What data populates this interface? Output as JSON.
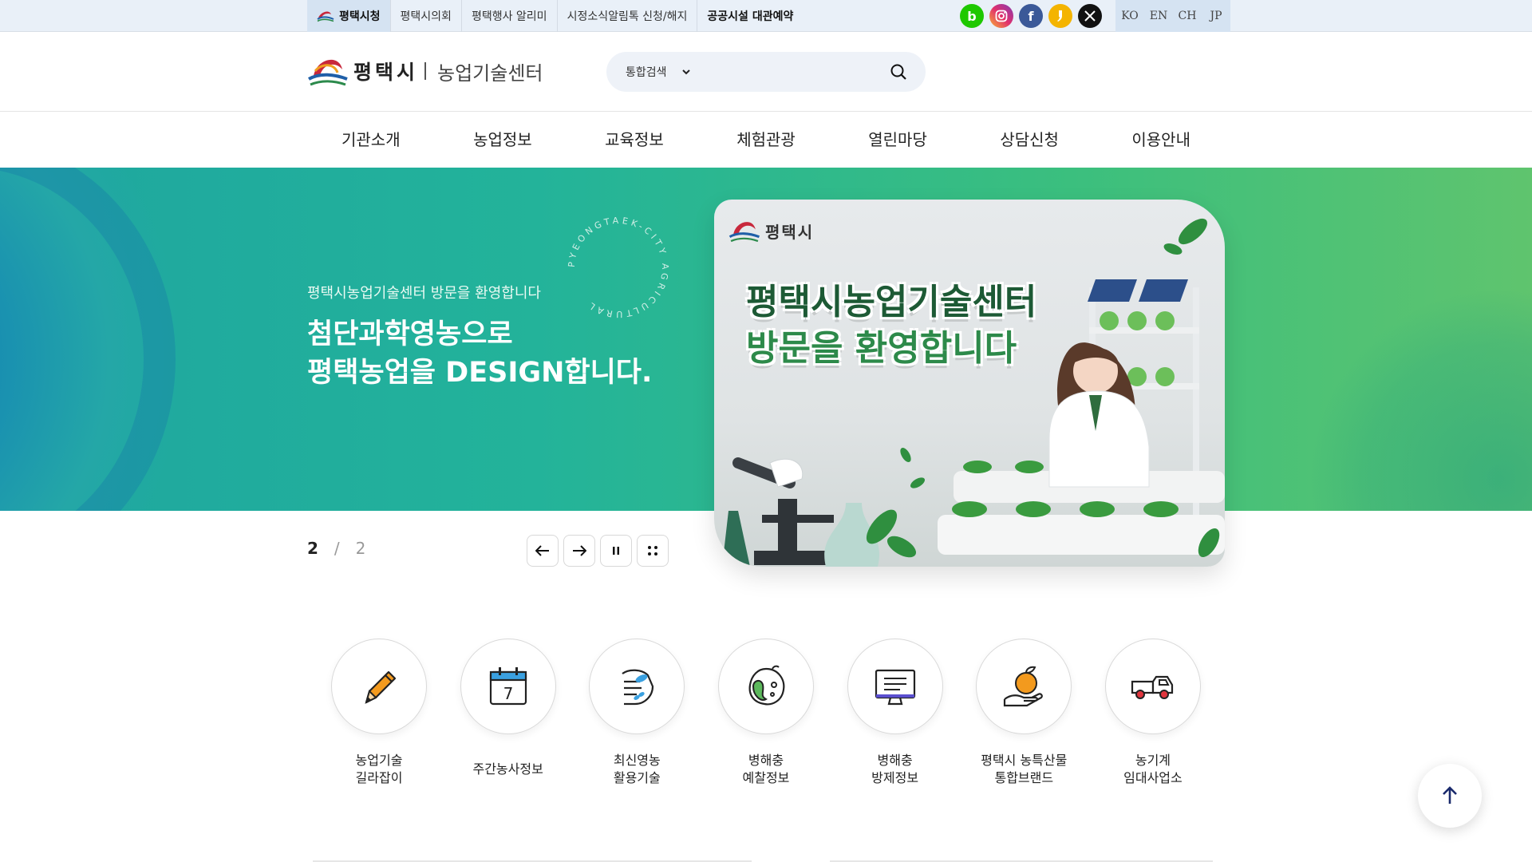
{
  "topbar": {
    "links": [
      "평택시청",
      "평택시의회",
      "평택행사 알리미",
      "시정소식알림톡 신청/해지",
      "공공시설 대관예약"
    ],
    "socials": [
      {
        "name": "blog",
        "glyph": "b",
        "color": "#1ec800"
      },
      {
        "name": "instagram",
        "glyph": "◎",
        "color": "#d6249f"
      },
      {
        "name": "facebook",
        "glyph": "f",
        "color": "#3b5998"
      },
      {
        "name": "kakao",
        "glyph": "❜",
        "color": "#f4b400"
      },
      {
        "name": "x",
        "glyph": "𝕏",
        "color": "#111111"
      }
    ],
    "languages": [
      "KO",
      "EN",
      "CH",
      "JP"
    ]
  },
  "header": {
    "logo_city": "평택시",
    "logo_org": "농업기술센터",
    "search_scope": "통합검색",
    "search_placeholder": ""
  },
  "gnb": [
    "기관소개",
    "농업정보",
    "교육정보",
    "체험관광",
    "열린마당",
    "상담신청",
    "이용안내"
  ],
  "hero": {
    "subtitle": "평택시농업기술센터 방문을 환영합니다",
    "title_line1": "첨단과학영농으로",
    "title_line2": "평택농업을 DESIGN합니다.",
    "circle_text": "PYEONGTAEK-CITY AGRICULTURAL",
    "card_logo": "평택시",
    "card_title_line1": "평택시농업기술센터",
    "card_title_line2": "방문을 환영합니다"
  },
  "slider": {
    "current": "2",
    "separator": "/",
    "total": "2"
  },
  "quick_menu": [
    {
      "icon": "pencil-icon",
      "line1": "농업기술",
      "line2": "길라잡이"
    },
    {
      "icon": "calendar-icon",
      "line1": "주간농사정보",
      "line2": ""
    },
    {
      "icon": "hand-seed-icon",
      "line1": "최신영농",
      "line2": "활용기술"
    },
    {
      "icon": "bug-icon",
      "line1": "병해충",
      "line2": "예찰정보"
    },
    {
      "icon": "monitor-icon",
      "line1": "병해충",
      "line2": "방제정보"
    },
    {
      "icon": "orange-hand-icon",
      "line1": "평택시 농특산물",
      "line2": "통합브랜드"
    },
    {
      "icon": "truck-icon",
      "line1": "농기계",
      "line2": "임대사업소"
    }
  ],
  "colors": {
    "hero_start": "#1ea6a0",
    "hero_end": "#5fc46e",
    "topbar_bg": "#e9f0f8",
    "accent_orange": "#f39a1e"
  }
}
